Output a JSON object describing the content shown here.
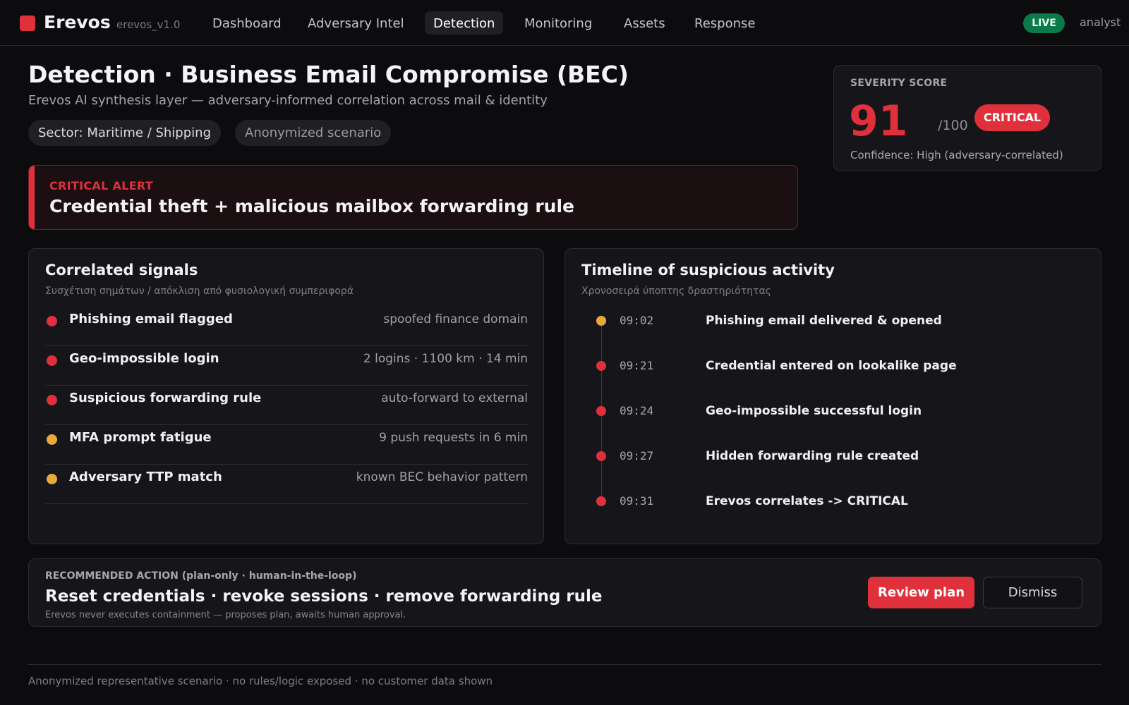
{
  "app": {
    "brand": "Erevos",
    "version": "erevos_v1.0",
    "brand_color": "#e0303c"
  },
  "nav": {
    "items": [
      "Dashboard",
      "Adversary Intel",
      "Detection",
      "Monitoring",
      "Assets",
      "Response"
    ],
    "active": "Detection",
    "live_label": "LIVE",
    "user": "analyst"
  },
  "header": {
    "title": "Detection · Business Email Compromise (BEC)",
    "subtitle": "Erevos AI synthesis layer — adversary-informed correlation across mail & identity",
    "chips": [
      "Sector: Maritime / Shipping",
      "Anonymized scenario"
    ]
  },
  "severity": {
    "label": "SEVERITY SCORE",
    "score": "91",
    "max": "/100",
    "level": "CRITICAL",
    "confidence": "Confidence: High (adversary-correlated)"
  },
  "alert": {
    "kicker": "CRITICAL ALERT",
    "text": "Credential theft + malicious mailbox forwarding rule"
  },
  "signals": {
    "title": "Correlated signals",
    "subtitle": "Συσχέτιση σημάτων / απόκλιση από φυσιολογική συμπεριφορά",
    "items": [
      {
        "name": "Phishing email flagged",
        "detail": "spoofed finance domain",
        "severity": "high",
        "color": "#e0303c"
      },
      {
        "name": "Geo-impossible login",
        "detail": "2 logins · 1100 km · 14 min",
        "severity": "high",
        "color": "#e0303c"
      },
      {
        "name": "Suspicious forwarding rule",
        "detail": "auto-forward to external",
        "severity": "high",
        "color": "#e0303c"
      },
      {
        "name": "MFA prompt fatigue",
        "detail": "9 push requests in 6 min",
        "severity": "medium",
        "color": "#e8a93a"
      },
      {
        "name": "Adversary TTP match",
        "detail": "known BEC behavior pattern",
        "severity": "medium",
        "color": "#e8a93a"
      }
    ]
  },
  "timeline": {
    "title": "Timeline of suspicious activity",
    "subtitle": "Χρονοσειρά ύποπτης δραστηριότητας",
    "events": [
      {
        "time": "09:02",
        "event": "Phishing email delivered & opened",
        "color": "#e8a93a"
      },
      {
        "time": "09:21",
        "event": "Credential entered on lookalike page",
        "color": "#e0303c"
      },
      {
        "time": "09:24",
        "event": "Geo-impossible successful login",
        "color": "#e0303c"
      },
      {
        "time": "09:27",
        "event": "Hidden forwarding rule created",
        "color": "#e0303c"
      },
      {
        "time": "09:31",
        "event": "Erevos correlates -> CRITICAL",
        "color": "#e0303c"
      }
    ]
  },
  "action": {
    "kicker": "RECOMMENDED ACTION (plan-only · human-in-the-loop)",
    "title": "Reset credentials · revoke sessions · remove forwarding rule",
    "note": "Erevos never executes containment — proposes plan, awaits human approval.",
    "primary_label": "Review plan",
    "secondary_label": "Dismiss"
  },
  "footer": {
    "text": "Anonymized representative scenario · no rules/logic exposed · no customer data shown"
  }
}
